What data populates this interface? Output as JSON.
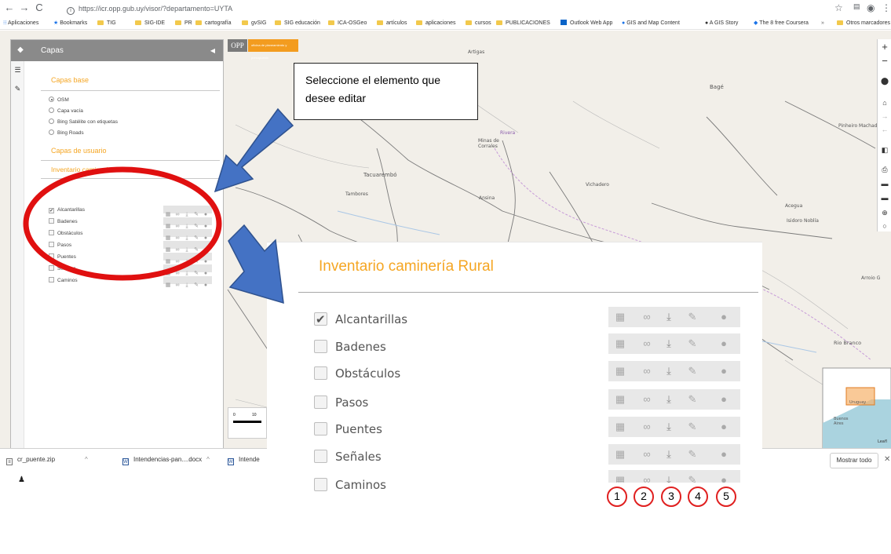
{
  "browser": {
    "url": "https://icr.opp.gub.uy/visor/?departamento=UYTA",
    "bookmarks": [
      "Aplicaciones",
      "Bookmarks",
      "TIG",
      "SIG-IDE",
      "PR",
      "cartografía",
      "gvSIG",
      "SIG educación",
      "ICA-OSGeo",
      "artículos",
      "aplicaciones",
      "cursos",
      "PUBLICACIONES",
      "Outlook Web App",
      "GIS and Map Content",
      "A GIS Story",
      "The 8 free Coursera",
      "Otros marcadores"
    ]
  },
  "map": {
    "places": [
      "Tacuarembó",
      "Tambores",
      "Ansina",
      "Vichadero",
      "Bagé",
      "Pinheiro Machado",
      "Acegua",
      "Isidoro Noblía",
      "Rivera",
      "Minas de Corrales",
      "Rio Branco",
      "Arroio G",
      "Buenos Aires",
      "Uruguay",
      "Leafl"
    ],
    "scale": {
      "start": "0",
      "end": "10"
    }
  },
  "branding": {
    "logo": "OPP",
    "tagline": "oficina de planeamiento y presupuesto"
  },
  "panel": {
    "title": "Capas",
    "base_title": "Capas base",
    "base_layers": [
      {
        "label": "OSM",
        "selected": true
      },
      {
        "label": "Capa vacía",
        "selected": false
      },
      {
        "label": "Bing Satélite con etiquetas",
        "selected": false
      },
      {
        "label": "Bing Roads",
        "selected": false
      }
    ],
    "data_title": "Capas de usuario",
    "group_title": "Inventario caminería Rural",
    "layers": [
      {
        "label": "Alcantarillas",
        "checked": true
      },
      {
        "label": "Badenes",
        "checked": false
      },
      {
        "label": "Obstáculos",
        "checked": false
      },
      {
        "label": "Pasos",
        "checked": false
      },
      {
        "label": "Puentes",
        "checked": false
      },
      {
        "label": "Señales",
        "checked": false
      },
      {
        "label": "Caminos",
        "checked": false
      }
    ]
  },
  "callout": {
    "text": "Seleccione el elemento que desee editar"
  },
  "zoom": {
    "title": "Inventario caminería Rural",
    "numbers": [
      "1",
      "2",
      "3",
      "4",
      "5"
    ]
  },
  "downloads": {
    "items": [
      "cr_puente.zip",
      "Intendencias-pan....docx",
      "Intende"
    ],
    "show_all": "Mostrar todo"
  }
}
